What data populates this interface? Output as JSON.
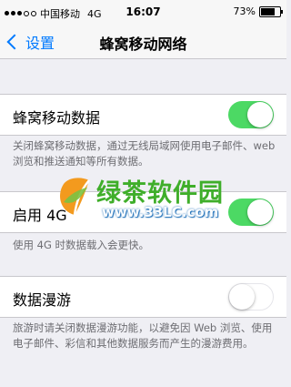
{
  "status_bar": {
    "carrier": "中国移动",
    "network": "4G",
    "time": "16:07",
    "battery_percent": "73%",
    "battery_level": 0.73
  },
  "nav": {
    "back_label": "设置",
    "title": "蜂窝移动网络"
  },
  "settings": {
    "cellular_data": {
      "label": "蜂窝移动数据",
      "on": true,
      "footer": "关闭蜂窝移动数据，通过无线局域网使用电子邮件、web 浏览和推送通知等所有数据。"
    },
    "enable_4g": {
      "label": "启用 4G",
      "on": true,
      "footer": "使用 4G 时数据载入会更快。"
    },
    "data_roaming": {
      "label": "数据漫游",
      "on": false,
      "footer": "旅游时请关闭数据漫游功能，以避免因 Web 浏览、使用电子邮件、彩信和其他数据服务而产生的漫游费用。"
    }
  },
  "watermark": {
    "brand": "绿茶软件园",
    "url": "www.33LC.com"
  },
  "colors": {
    "accent": "#007aff",
    "toggle_on": "#4cd964",
    "background": "#efeff4"
  }
}
